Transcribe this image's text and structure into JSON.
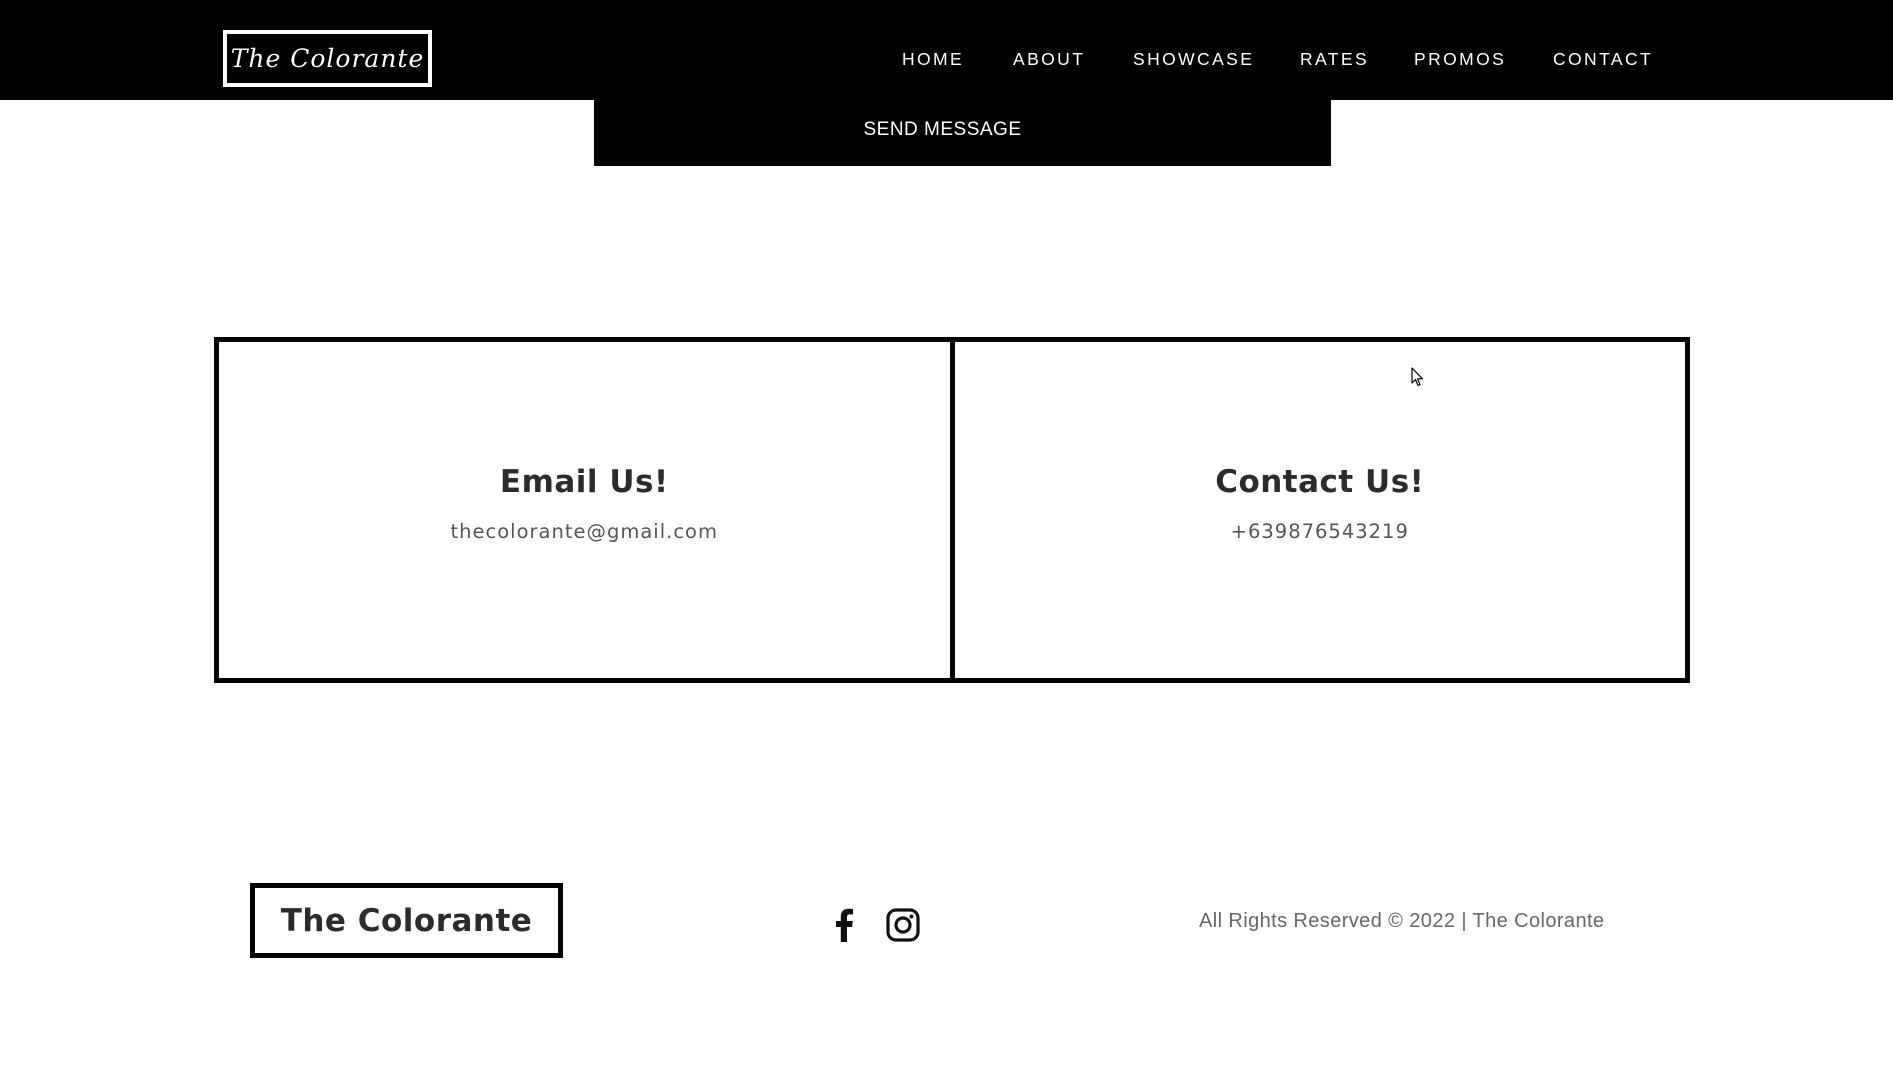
{
  "brand": {
    "logo_text": "The Colorante"
  },
  "nav": {
    "items": [
      {
        "label": "HOME"
      },
      {
        "label": "ABOUT"
      },
      {
        "label": "SHOWCASE"
      },
      {
        "label": "RATES"
      },
      {
        "label": "PROMOS"
      },
      {
        "label": "CONTACT"
      }
    ]
  },
  "send_message": {
    "label": "SEND MESSAGE"
  },
  "contact_cards": {
    "email": {
      "title": "Email Us!",
      "value": "thecolorante@gmail.com"
    },
    "phone": {
      "title": "Contact Us!",
      "value": "+639876543219"
    }
  },
  "footer": {
    "logo_text": "The Colorante",
    "social": [
      {
        "icon": "facebook-icon"
      },
      {
        "icon": "instagram-icon"
      }
    ],
    "copyright": "All Rights Reserved © 2022 | The Colorante"
  },
  "colors": {
    "header_bg": "#000000",
    "text_dark": "#2b2b2b",
    "text_muted": "#666666"
  }
}
